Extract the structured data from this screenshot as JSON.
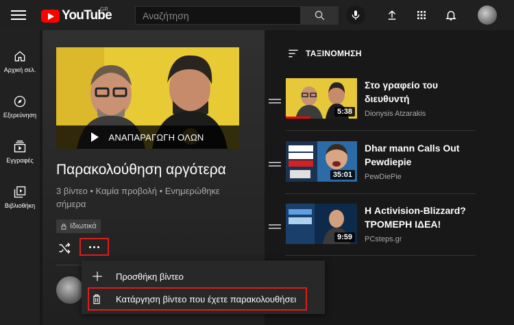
{
  "header": {
    "region": "GR",
    "logo_text": "YouTube",
    "search_placeholder": "Αναζήτηση"
  },
  "sidebar": {
    "items": [
      {
        "label": "Αρχική σελ.",
        "icon": "home-icon"
      },
      {
        "label": "Εξερεύνηση",
        "icon": "compass-icon"
      },
      {
        "label": "Εγγραφές",
        "icon": "subscriptions-icon"
      },
      {
        "label": "Βιβλιοθήκη",
        "icon": "library-icon"
      }
    ]
  },
  "playlist": {
    "play_all_label": "ΑΝΑΠΑΡΑΓΩΓΗ ΟΛΩΝ",
    "title": "Παρακολούθηση αργότερα",
    "meta": "3 βίντεο • Καμία προβολή • Ενημερώθηκε σήμερα",
    "privacy": "Ιδιωτικά"
  },
  "menu": {
    "items": [
      {
        "label": "Προσθήκη βίντεο",
        "icon": "plus-icon"
      },
      {
        "label": "Κατάργηση βίντεο που έχετε παρακολουθήσει",
        "icon": "trash-icon"
      }
    ]
  },
  "sort_label": "ΤΑΞΙΝΟΜΗΣΗ",
  "videos": [
    {
      "title": "Στο γραφείο του διευθυντή",
      "channel": "Dionysis Atzarakis",
      "duration": "5:38",
      "progress": 0.35
    },
    {
      "title": "Dhar mann Calls Out Pewdiepie",
      "channel": "PewDiePie",
      "duration": "35:01",
      "progress": 0
    },
    {
      "title": "Η Activision-Blizzard? ΤΡΟΜΕΡΗ ΙΔΕΑ!",
      "channel": "PCsteps.gr",
      "duration": "9:59",
      "progress": 0
    }
  ],
  "colors": {
    "accent_red": "#ff0000",
    "highlight_box": "#e21b1b",
    "background": "#181818"
  }
}
